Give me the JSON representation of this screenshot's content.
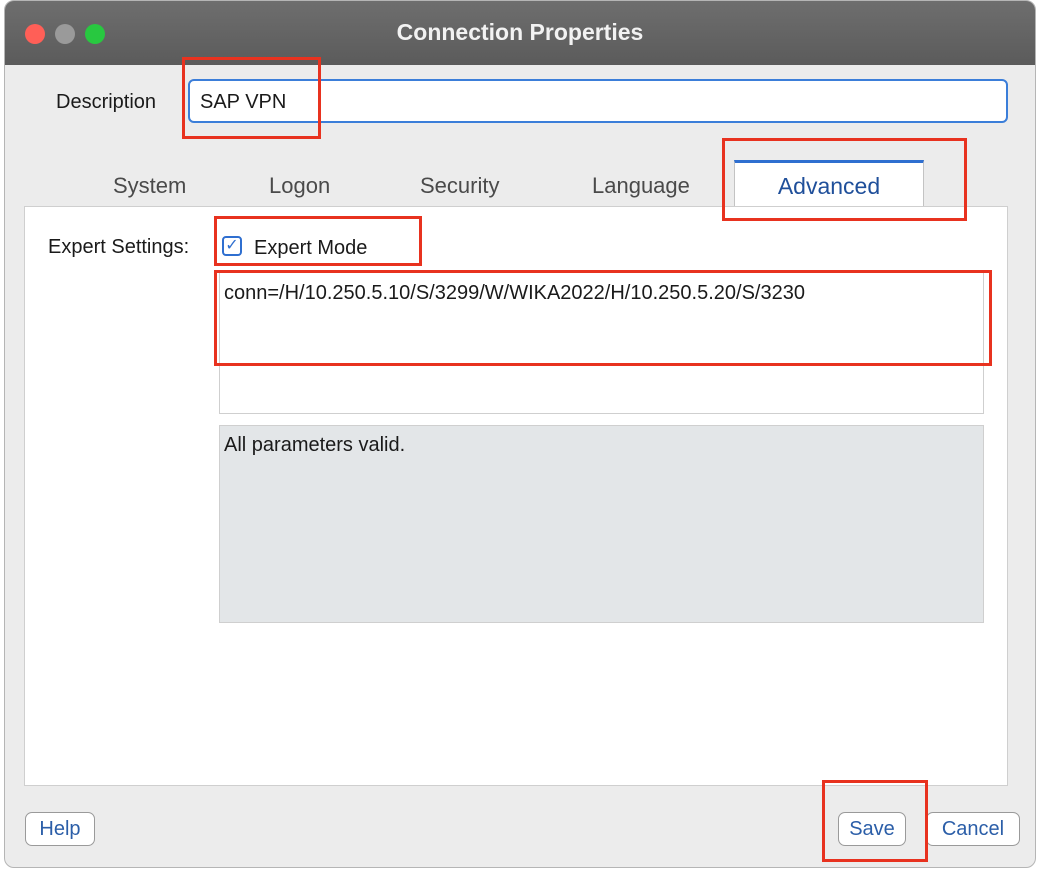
{
  "window": {
    "title": "Connection Properties"
  },
  "description": {
    "label": "Description",
    "value": "SAP VPN"
  },
  "tabs": [
    {
      "label": "System"
    },
    {
      "label": "Logon"
    },
    {
      "label": "Security"
    },
    {
      "label": "Language"
    },
    {
      "label": "Advanced",
      "active": true
    }
  ],
  "advanced": {
    "expert_settings_label": "Expert Settings:",
    "expert_mode_label": "Expert Mode",
    "expert_mode_checked": true,
    "connection_string": "conn=/H/10.250.5.10/S/3299/W/WIKA2022/H/10.250.5.20/S/3230",
    "status_message": "All parameters valid."
  },
  "buttons": {
    "help": "Help",
    "save": "Save",
    "cancel": "Cancel"
  },
  "colors": {
    "highlight": "#e8321f",
    "accent": "#2f6fd0"
  }
}
